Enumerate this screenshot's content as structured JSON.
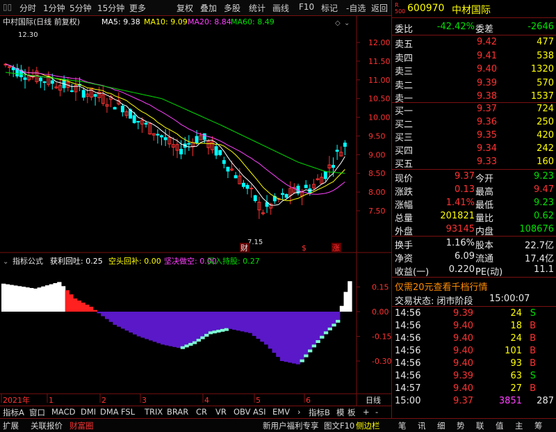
{
  "menu": {
    "items": [
      "分时",
      "1分钟",
      "5分钟",
      "15分钟",
      "更多",
      "复权",
      "叠加",
      "多股",
      "统计",
      "画线",
      "F10",
      "标记",
      "-自选",
      "返回"
    ]
  },
  "main_chart": {
    "title": "中村国际(日线 前复权)",
    "ma": [
      {
        "label": "MA5: 9.38",
        "color": "#ffffff"
      },
      {
        "label": "MA10: 9.09",
        "color": "#ffff00"
      },
      {
        "label": "MA20: 8.84",
        "color": "#ff40ff"
      },
      {
        "label": "MA60: 8.49",
        "color": "#00e000"
      }
    ],
    "high_label": "12.30",
    "low_label": "7.15",
    "yaxis": [
      "12.00",
      "11.50",
      "11.00",
      "10.50",
      "10.00",
      "9.50",
      "9.00",
      "8.50",
      "8.00",
      "7.50"
    ],
    "markers": [
      {
        "text": "财"
      },
      {
        "text": "$"
      },
      {
        "text": "涨"
      }
    ]
  },
  "indicator": {
    "title": "指标公式",
    "items": [
      {
        "label": "获利回吐: 0.25",
        "color": "#ffffff"
      },
      {
        "label": "空头回补: 0.00",
        "color": "#ffff00"
      },
      {
        "label": "坚决做空: 0.00",
        "color": "#ff40ff"
      },
      {
        "label": "买入持股: 0.27",
        "color": "#00e000"
      }
    ],
    "yaxis": [
      "0.15",
      "0.00",
      "-0.15",
      "-0.30"
    ]
  },
  "xaxis": {
    "labels": [
      "2021年",
      "1",
      "2",
      "3",
      "4",
      "5",
      "6"
    ],
    "right": "日线"
  },
  "tabs1": [
    "指标A",
    "窗口",
    "MACD",
    "DMI",
    "DMA",
    "FSL",
    "TRIX",
    "BRAR",
    "CR",
    "VR",
    "OBV",
    "ASI",
    "EMV",
    "指标B",
    "模",
    "板",
    "+",
    "-"
  ],
  "tabs2": [
    {
      "label": "扩展",
      "color": "#d8d8d8"
    },
    {
      "label": "关联报价",
      "color": "#d8d8d8"
    },
    {
      "label": "财富圈",
      "color": "#ff3232"
    },
    {
      "label": "新用户福利专享",
      "color": "#d8d8d8"
    },
    {
      "label": "图文F10",
      "color": "#d8d8d8"
    },
    {
      "label": "侧边栏",
      "color": "#ffff00"
    },
    {
      "label": "笔",
      "color": "#d8d8d8"
    },
    {
      "label": "讯",
      "color": "#d8d8d8"
    },
    {
      "label": "细",
      "color": "#d8d8d8"
    },
    {
      "label": "势",
      "color": "#d8d8d8"
    },
    {
      "label": "联",
      "color": "#d8d8d8"
    },
    {
      "label": "值",
      "color": "#d8d8d8"
    },
    {
      "label": "主",
      "color": "#d8d8d8"
    },
    {
      "label": "筹",
      "color": "#d8d8d8"
    }
  ],
  "stock": {
    "code": "600970",
    "name": "中材国际",
    "badge_top": "R",
    "badge_bottom": "500"
  },
  "weibi": {
    "label1": "委比",
    "value1": "-42.42%",
    "label2": "委差",
    "value2": "-2646"
  },
  "sell": [
    {
      "label": "卖五",
      "price": "9.42",
      "vol": "477"
    },
    {
      "label": "卖四",
      "price": "9.41",
      "vol": "538"
    },
    {
      "label": "卖三",
      "price": "9.40",
      "vol": "1320"
    },
    {
      "label": "卖二",
      "price": "9.39",
      "vol": "570"
    },
    {
      "label": "卖一",
      "price": "9.38",
      "vol": "1537"
    }
  ],
  "buy": [
    {
      "label": "买一",
      "price": "9.37",
      "vol": "724"
    },
    {
      "label": "买二",
      "price": "9.36",
      "vol": "250"
    },
    {
      "label": "买三",
      "price": "9.35",
      "vol": "420"
    },
    {
      "label": "买四",
      "price": "9.34",
      "vol": "242"
    },
    {
      "label": "买五",
      "price": "9.33",
      "vol": "160"
    }
  ],
  "quote": [
    {
      "l1": "现价",
      "v1": "9.37",
      "c1": "#ff3232",
      "l2": "今开",
      "v2": "9.23",
      "c2": "#00e000"
    },
    {
      "l1": "涨跌",
      "v1": "0.13",
      "c1": "#ff3232",
      "l2": "最高",
      "v2": "9.47",
      "c2": "#ff3232"
    },
    {
      "l1": "涨幅",
      "v1": "1.41%",
      "c1": "#ff3232",
      "l2": "最低",
      "v2": "9.23",
      "c2": "#00e000"
    },
    {
      "l1": "总量",
      "v1": "201821",
      "c1": "#ffff00",
      "l2": "量比",
      "v2": "0.62",
      "c2": "#00e000"
    },
    {
      "l1": "外盘",
      "v1": "93145",
      "c1": "#ff3232",
      "l2": "内盘",
      "v2": "108676",
      "c2": "#00e000"
    }
  ],
  "stats": [
    {
      "l1": "换手",
      "v1": "1.16%",
      "l2": "股本",
      "v2": "22.7亿"
    },
    {
      "l1": "净资",
      "v1": "6.09",
      "l2": "流通",
      "v2": "17.4亿"
    },
    {
      "l1": "收益(一)",
      "v1": "0.220",
      "l2": "PE(动)",
      "v2": "11.1"
    }
  ],
  "promo": "仅需20元查看千档行情",
  "status": {
    "label": "交易状态: 闭市阶段",
    "time": "15:00:07"
  },
  "ticks": [
    {
      "time": "14:56",
      "price": "9.39",
      "vol": "24",
      "side": "S"
    },
    {
      "time": "14:56",
      "price": "9.40",
      "vol": "18",
      "side": "B"
    },
    {
      "time": "14:56",
      "price": "9.40",
      "vol": "24",
      "side": "B"
    },
    {
      "time": "14:56",
      "price": "9.40",
      "vol": "101",
      "side": "B"
    },
    {
      "time": "14:56",
      "price": "9.40",
      "vol": "93",
      "side": "B"
    },
    {
      "time": "14:56",
      "price": "9.39",
      "vol": "63",
      "side": "S"
    },
    {
      "time": "14:57",
      "price": "9.40",
      "vol": "27",
      "side": "B"
    },
    {
      "time": "15:00",
      "price": "9.37",
      "vol": "3851",
      "side": "",
      "extra": "287"
    }
  ],
  "colors": {
    "up": "#ff3232",
    "down": "#00ffff",
    "bg": "#000000",
    "border": "#7a1010",
    "ma5": "#ffffff",
    "ma10": "#ffff00",
    "ma20": "#ff40ff",
    "ma60": "#00e000",
    "indicator_neg": "#5a18c8",
    "indicator_edge": "#7fffd4",
    "indicator_pos": "#ffffff",
    "indicator_red": "#ff2020"
  }
}
